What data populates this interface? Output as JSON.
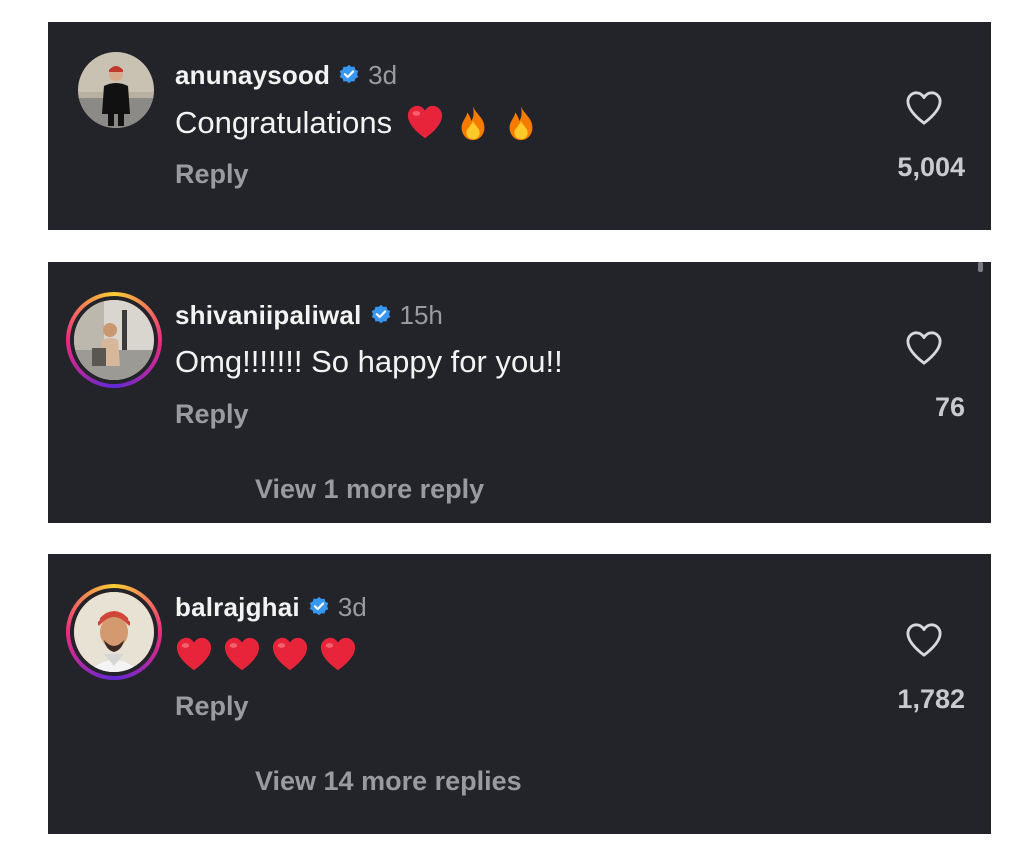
{
  "colors": {
    "card_bg": "#232429",
    "text_primary": "#f3f3f4",
    "text_secondary": "#9a9ba0",
    "verified_blue": "#3897f0",
    "heart_red": "#e8243a",
    "story_ring": [
      "#f9ce34",
      "#ee2a7b",
      "#6228d7"
    ]
  },
  "comments": [
    {
      "username": "anunaysood",
      "verified": true,
      "time": "3d",
      "text": "Congratulations",
      "emojis": [
        "red-heart-emoji",
        "fire-emoji",
        "fire-emoji"
      ],
      "reply_label": "Reply",
      "likes": "5,004",
      "like_icon": "heart-outline-icon",
      "avatar": "user-avatar-photo",
      "story_ring": false
    },
    {
      "username": "shivaniipaliwal",
      "verified": true,
      "time": "15h",
      "text": "Omg!!!!!!! So happy for you!!",
      "emojis": [],
      "reply_label": "Reply",
      "likes": "76",
      "like_icon": "heart-outline-icon",
      "avatar": "user-avatar-photo",
      "story_ring": true,
      "more_replies": "View 1 more reply"
    },
    {
      "username": "balrajghai",
      "verified": true,
      "time": "3d",
      "text": "",
      "emojis": [
        "red-heart-emoji",
        "red-heart-emoji",
        "red-heart-emoji",
        "red-heart-emoji"
      ],
      "reply_label": "Reply",
      "likes": "1,782",
      "like_icon": "heart-outline-icon",
      "avatar": "user-avatar-photo",
      "story_ring": true,
      "more_replies": "View 14 more replies"
    }
  ]
}
